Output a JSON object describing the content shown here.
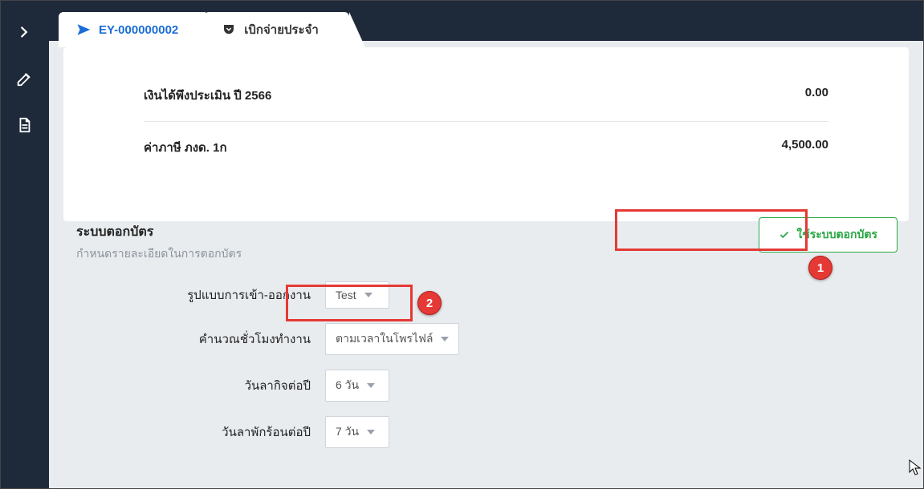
{
  "sidebar": {
    "icons": [
      "chevron-right",
      "edit",
      "document"
    ]
  },
  "tabs": [
    {
      "id": "EY-000000002",
      "icon": "paper-plane",
      "active": true
    },
    {
      "id": "เบิกจ่ายประจำ",
      "icon": "pocket",
      "active": false
    }
  ],
  "summary": [
    {
      "label": "เงินได้พึงประเมิน ปี 2566",
      "value": "0.00"
    },
    {
      "label": "ค่าภาษี ภงด. 1ก",
      "value": "4,500.00"
    }
  ],
  "attendance_section": {
    "title": "ระบบตอกบัตร",
    "subtitle": "กำหนดรายละเอียดในการตอกบัตร",
    "enable_button": "ใช้ระบบตอกบัตร"
  },
  "form": {
    "rows": [
      {
        "label": "รูปแบบการเข้า-ออกงาน",
        "value": "Test",
        "wide": false
      },
      {
        "label": "คำนวณชั่วโมงทำงาน",
        "value": "ตามเวลาในโพรไฟล์",
        "wide": true
      },
      {
        "label": "วันลากิจต่อปี",
        "value": "6 วัน",
        "wide": false
      },
      {
        "label": "วันลาพักร้อนต่อปี",
        "value": "7 วัน",
        "wide": false
      }
    ]
  },
  "annotations": {
    "badge1": "1",
    "badge2": "2"
  }
}
